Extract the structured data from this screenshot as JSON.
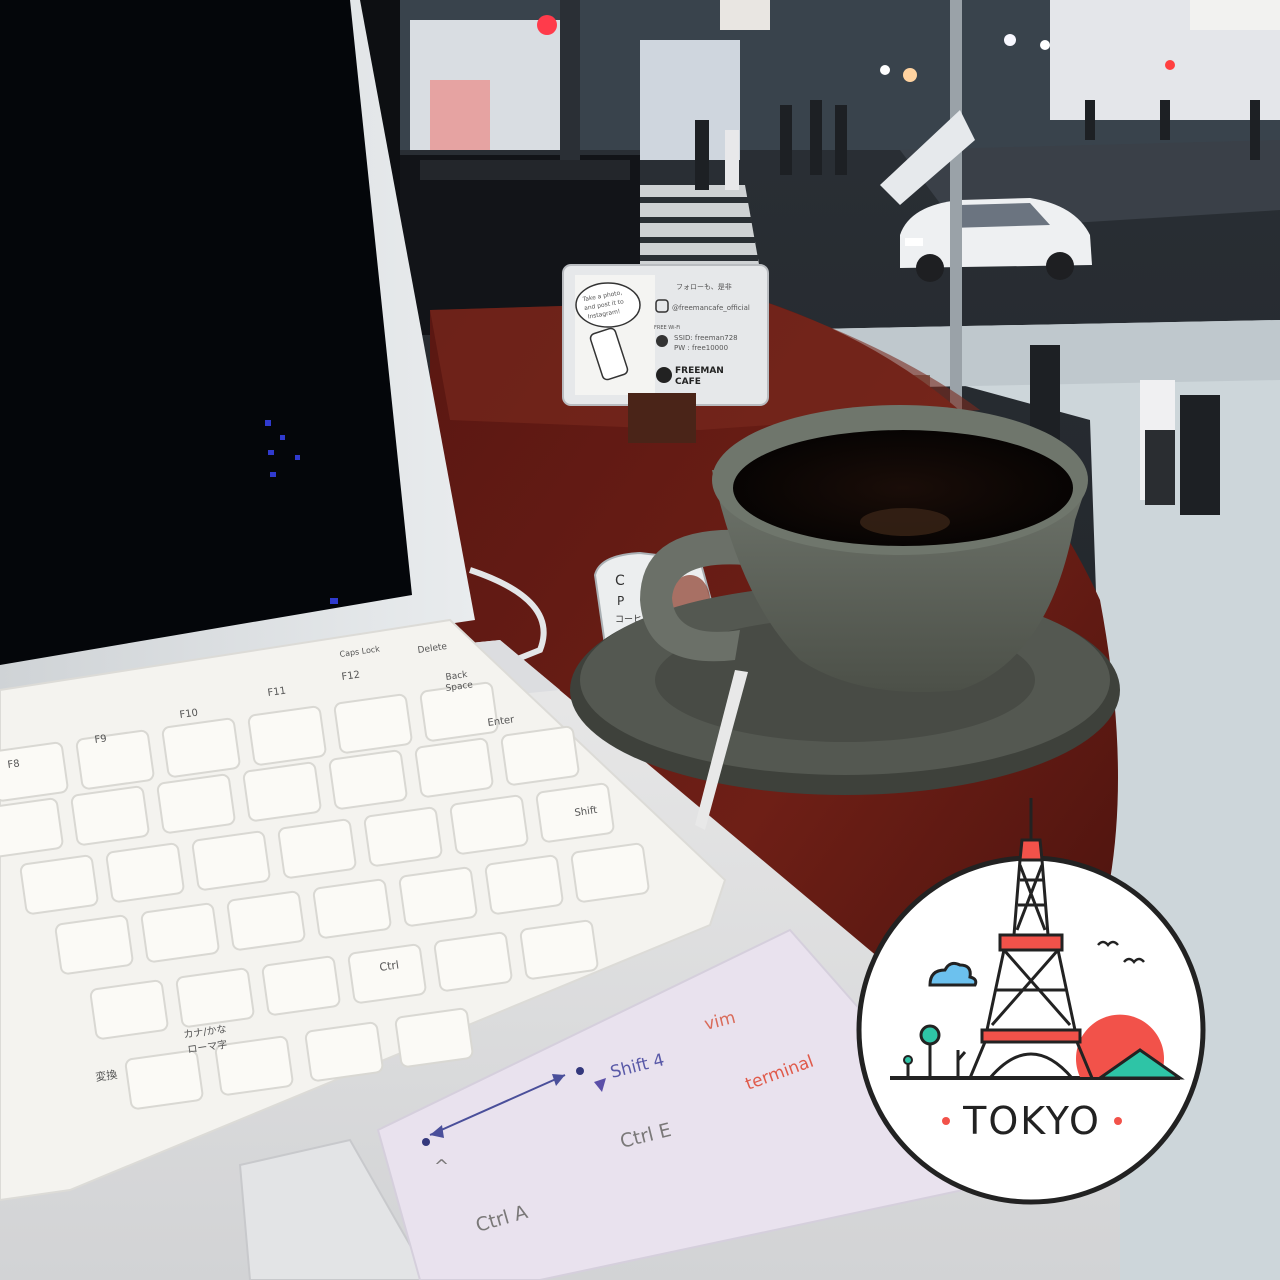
{
  "photo": {
    "tent_card": {
      "line1": "Take a photo,",
      "line2": "and post it to",
      "line3": "Instagram!",
      "follow": "フォローも、是非",
      "instagram": "@freemancafe_official",
      "wifi_label": "FREE Wi-Fi",
      "ssid": "SSID: freeman728",
      "password": "PW : free10000",
      "brand_top": "FREEMAN",
      "brand_bottom": "CAFE"
    },
    "creamer": {
      "line1": "C",
      "line2": "P",
      "line3": "コーヒ"
    },
    "keyboard": {
      "caps_lock": "Caps Lock",
      "delete": "Delete",
      "f11": "F11",
      "f12": "F12",
      "f10": "F10",
      "f9": "F9",
      "f8": "F8",
      "back_space_top": "Back",
      "back_space_bottom": "Space",
      "enter": "Enter",
      "shift": "Shift",
      "ctrl": "Ctrl",
      "henkan": "変換",
      "kana_top": "カナ/かな",
      "kana_bottom": "ローマ字"
    },
    "sticky_note": {
      "shift4": "Shift 4",
      "vim": "vim",
      "terminal": "terminal",
      "ctrl_e": "Ctrl E",
      "ctrl_a": "Ctrl A",
      "caret": "^"
    },
    "badge": {
      "text": "TOKYO"
    }
  }
}
